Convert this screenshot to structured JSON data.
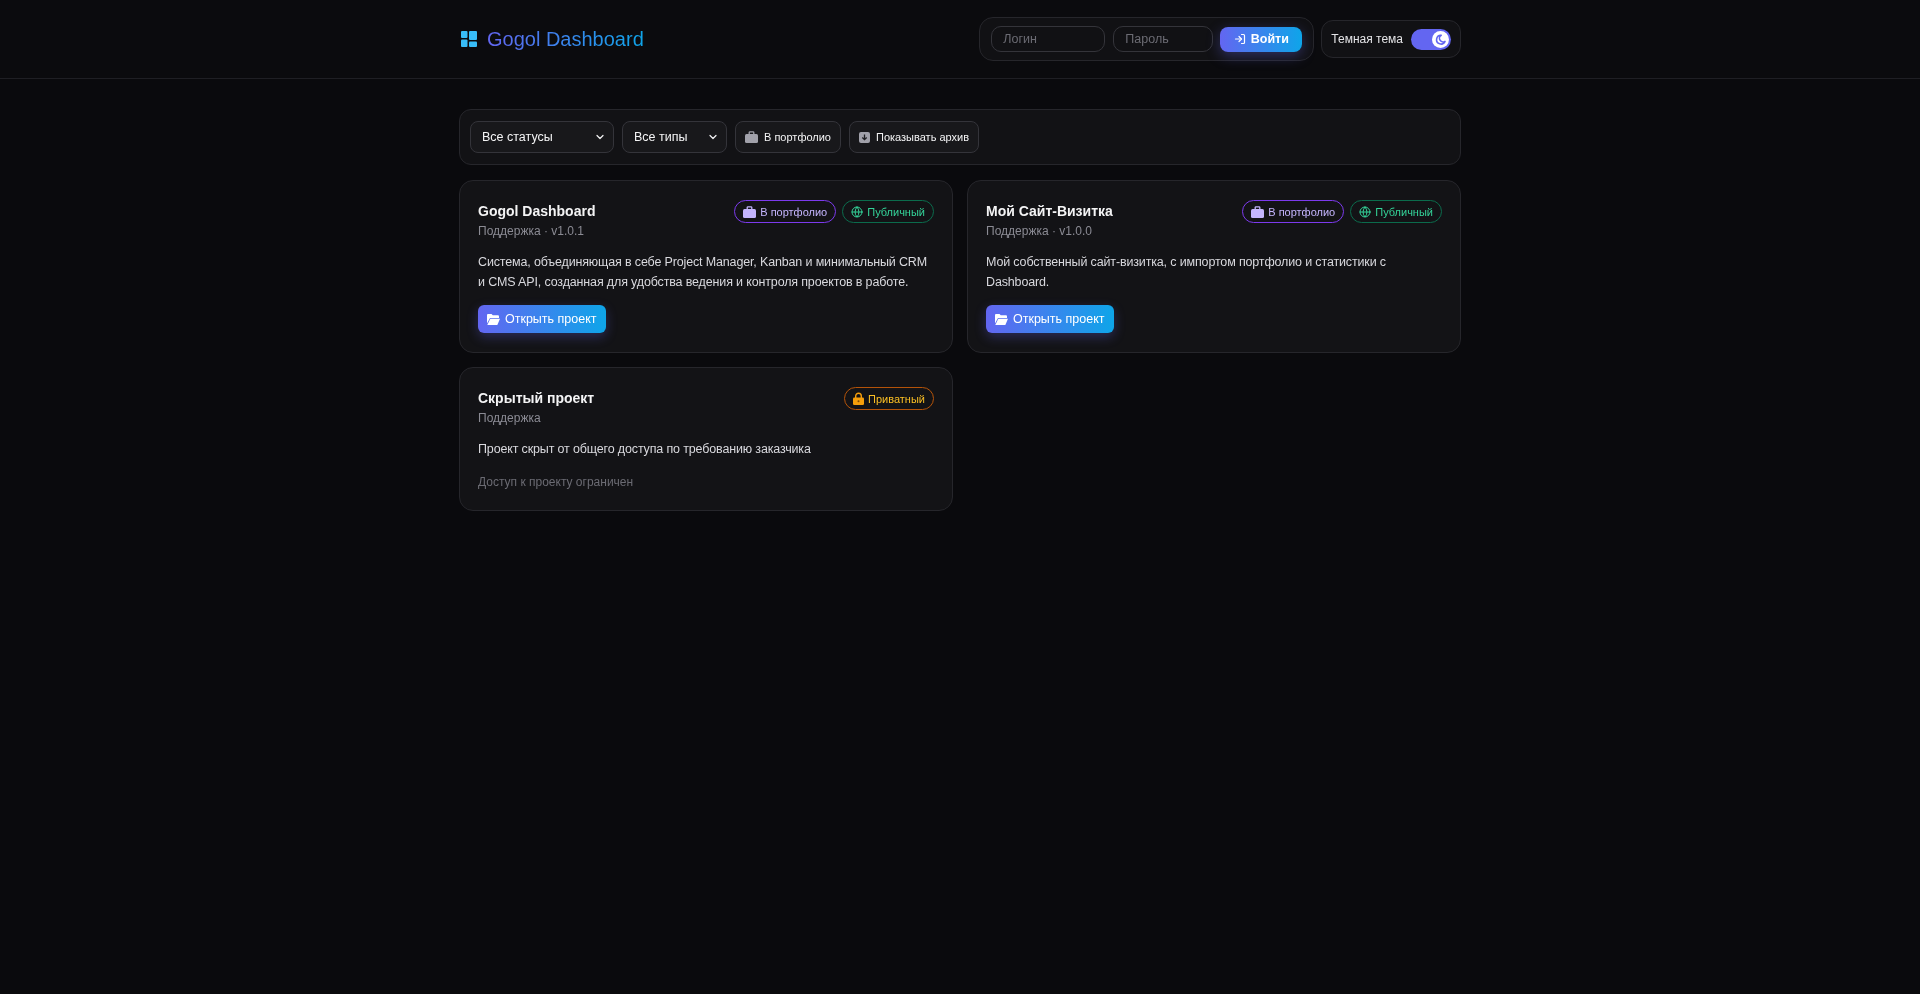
{
  "header": {
    "logo": "Gogol Dashboard",
    "login_field": {
      "placeholder": "Логин"
    },
    "password_field": {
      "placeholder": "Пароль"
    },
    "login_button": "Войти",
    "theme_toggle": {
      "label": "Темная тема",
      "on": true
    }
  },
  "filters": {
    "status_select": {
      "value": "Все статусы"
    },
    "type_select": {
      "value": "Все типы"
    },
    "buttons": [
      {
        "kind": "portfolio",
        "label": "В портфолио"
      },
      {
        "kind": "archive",
        "label": "Показывать архив"
      }
    ]
  },
  "projects": [
    {
      "title": "Gogol Dashboard",
      "meta": "Поддержка · v1.0.1",
      "badges": [
        {
          "kind": "portfolio",
          "label": "В портфолио"
        },
        {
          "kind": "public",
          "label": "Публичный"
        }
      ],
      "description": "Система, объединяющая в себе Project Manager, Kanban и минимальный CRM и CMS API, созданная для удобства ведения и контроля проектов в работе.",
      "action": {
        "kind": "button",
        "label": "Открыть проект"
      }
    },
    {
      "title": "Мой Сайт-Визитка",
      "meta": "Поддержка · v1.0.0",
      "badges": [
        {
          "kind": "portfolio",
          "label": "В портфолио"
        },
        {
          "kind": "public",
          "label": "Публичный"
        }
      ],
      "description": "Мой собственный сайт-визитка, с импортом портфолио и статистики с Dashboard.",
      "action": {
        "kind": "button",
        "label": "Открыть проект"
      }
    },
    {
      "title": "Скрытый проект",
      "meta": "Поддержка",
      "badges": [
        {
          "kind": "private",
          "label": "Приватный"
        }
      ],
      "description": "Проект скрыт от общего доступа по требованию заказчика",
      "action": {
        "kind": "notice",
        "label": "Доступ к проекту ограничен"
      }
    }
  ]
}
